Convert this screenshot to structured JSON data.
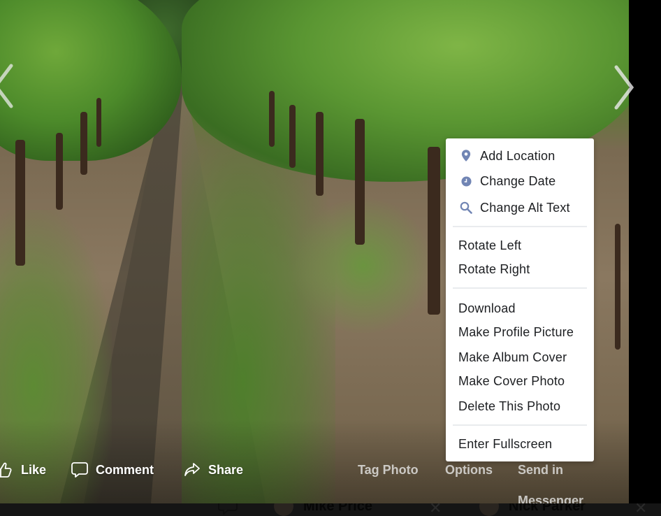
{
  "viewer": {
    "photo_description": "Vineyard rows with a dirt path under a clear sky",
    "nav": {
      "prev_icon": "chevron-left-icon",
      "next_icon": "chevron-right-icon"
    }
  },
  "actions": {
    "like": {
      "label": "Like",
      "icon": "thumbs-up-icon"
    },
    "comment": {
      "label": "Comment",
      "icon": "comment-bubble-icon"
    },
    "share": {
      "label": "Share",
      "icon": "share-arrow-icon"
    },
    "tag_photo": "Tag Photo",
    "options": "Options",
    "send_in_messenger": "Send in Messenger"
  },
  "options_menu": {
    "groups": [
      {
        "items": [
          {
            "label": "Add Location",
            "icon": "location-pin-icon"
          },
          {
            "label": "Change Date",
            "icon": "clock-icon"
          },
          {
            "label": "Change Alt Text",
            "icon": "search-icon"
          }
        ]
      },
      {
        "items": [
          {
            "label": "Rotate Left"
          },
          {
            "label": "Rotate Right"
          }
        ]
      },
      {
        "items": [
          {
            "label": "Download"
          },
          {
            "label": "Make Profile Picture"
          },
          {
            "label": "Make Album Cover"
          },
          {
            "label": "Make Cover Photo"
          },
          {
            "label": "Delete This Photo"
          }
        ]
      },
      {
        "items": [
          {
            "label": "Enter Fullscreen"
          }
        ]
      }
    ],
    "icon_color": "#7185b4"
  },
  "chat_bar": {
    "tabs": [
      {
        "name": "Mike Price"
      },
      {
        "name": "Nick Parker"
      }
    ],
    "close_glyph": "✕"
  }
}
